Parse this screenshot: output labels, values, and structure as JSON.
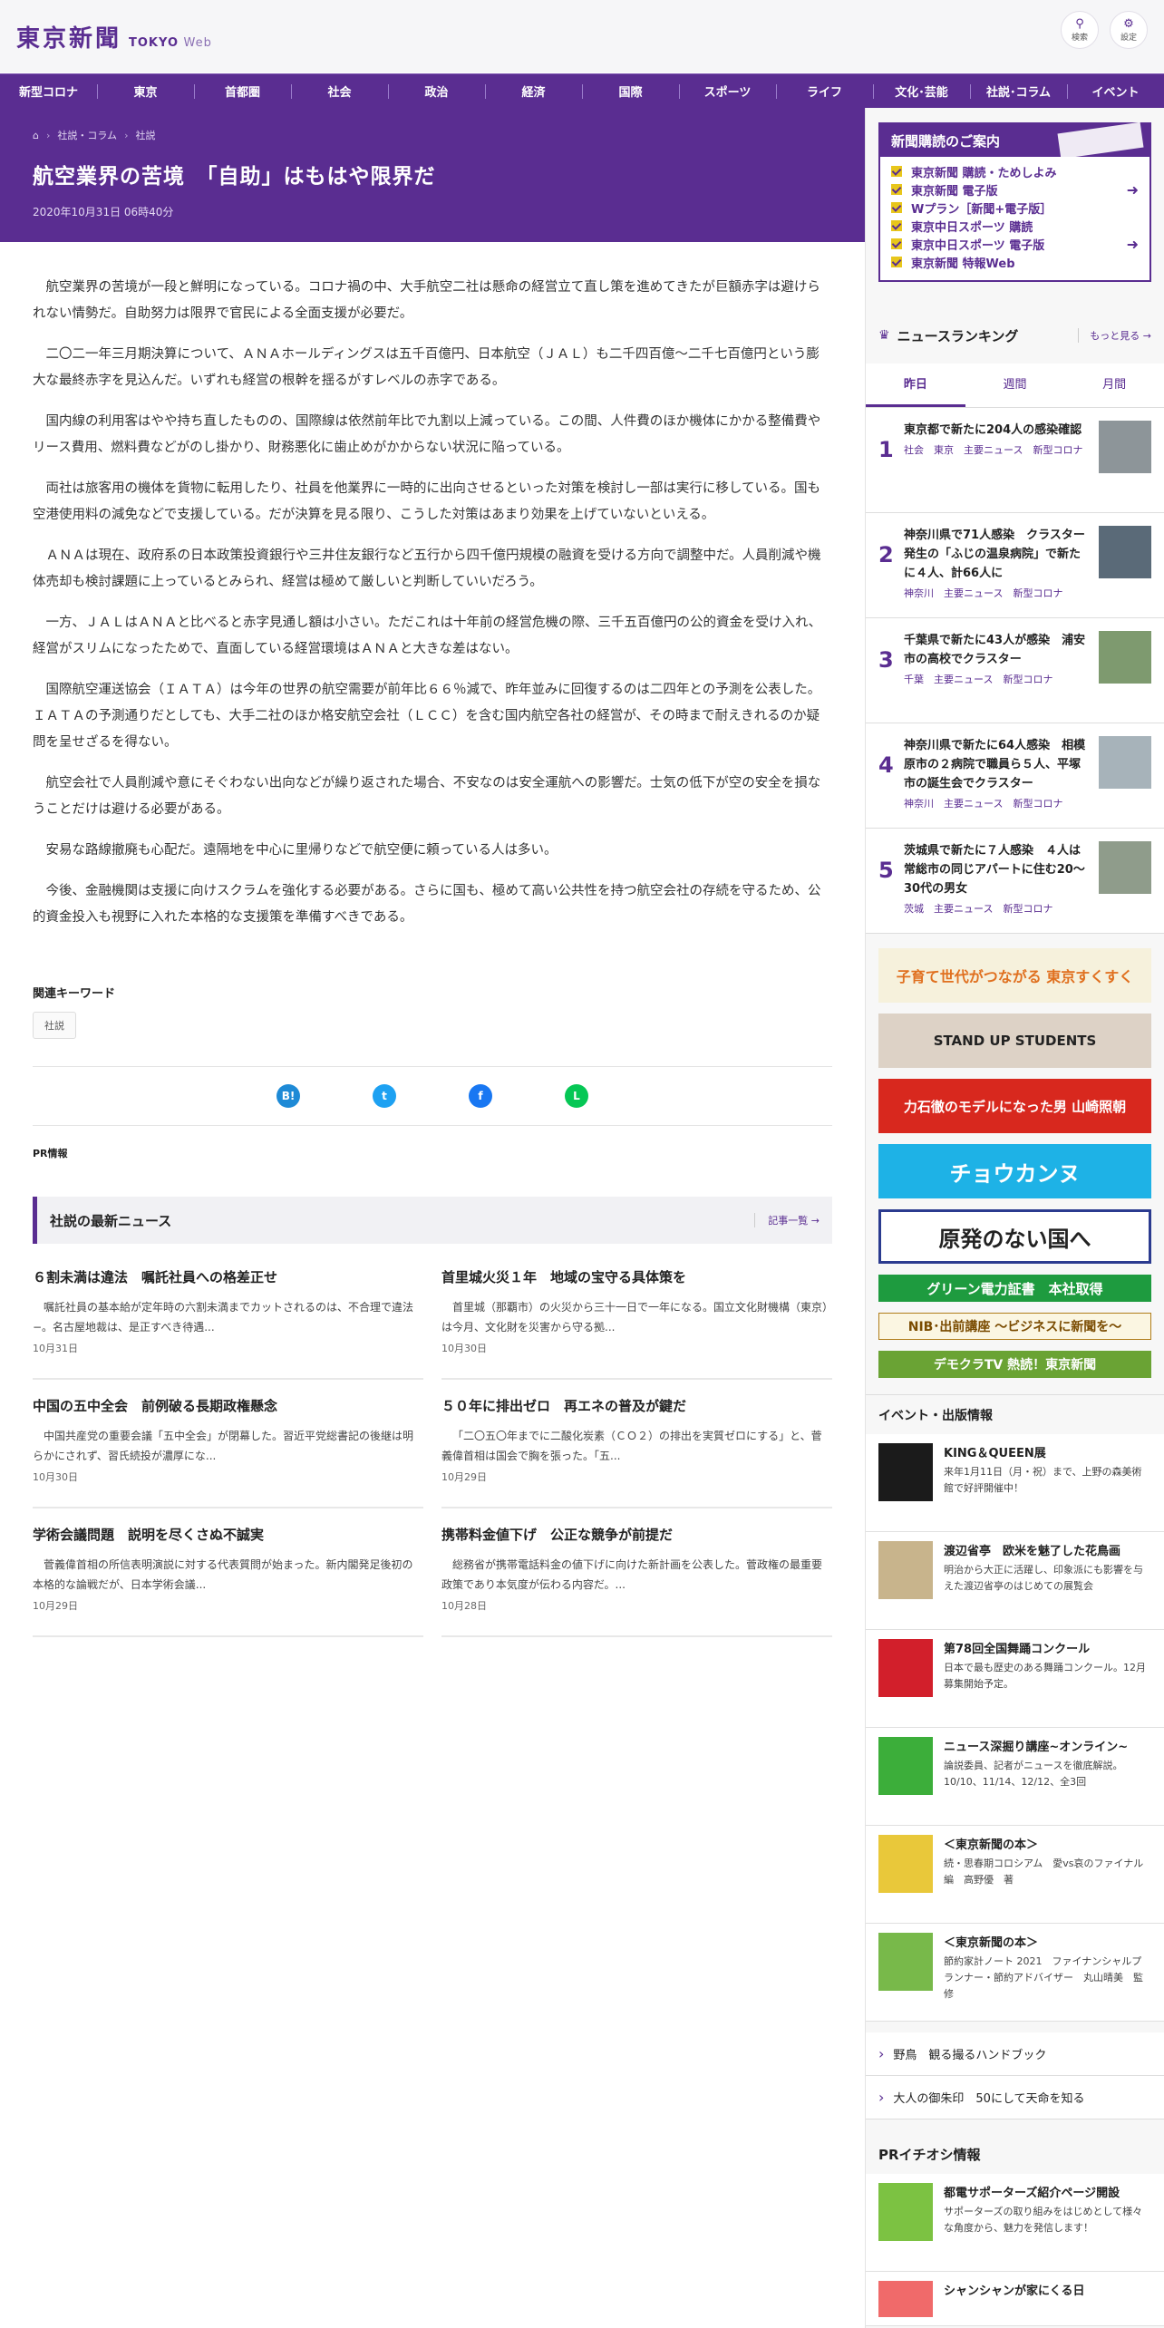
{
  "header": {
    "logo_jp": "東京新聞",
    "logo_en": "TOKYO",
    "logo_web": "Web",
    "search": "検索",
    "settings": "設定"
  },
  "nav": [
    "新型コロナ",
    "東京",
    "首都圏",
    "社会",
    "政治",
    "経済",
    "国際",
    "スポーツ",
    "ライフ",
    "文化･芸能",
    "社説･コラム",
    "イベント"
  ],
  "breadcrumb": {
    "level1": "社説・コラム",
    "level2": "社説"
  },
  "article": {
    "title": "航空業界の苦境　「自助」はもはや限界だ",
    "date": "2020年10月31日 06時40分",
    "paragraphs": [
      "航空業界の苦境が一段と鮮明になっている。コロナ禍の中、大手航空二社は懸命の経営立て直し策を進めてきたが巨額赤字は避けられない情勢だ。自助努力は限界で官民による全面支援が必要だ。",
      "二〇二一年三月期決算について、ＡＮＡホールディングスは五千百億円、日本航空（ＪＡＬ）も二千四百億〜二千七百億円という膨大な最終赤字を見込んだ。いずれも経営の根幹を揺るがすレベルの赤字である。",
      "国内線の利用客はやや持ち直したものの、国際線は依然前年比で九割以上減っている。この間、人件費のほか機体にかかる整備費やリース費用、燃料費などがのし掛かり、財務悪化に歯止めがかからない状況に陥っている。",
      "両社は旅客用の機体を貨物に転用したり、社員を他業界に一時的に出向させるといった対策を検討し一部は実行に移している。国も空港使用料の減免などで支援している。だが決算を見る限り、こうした対策はあまり効果を上げていないといえる。",
      "ＡＮＡは現在、政府系の日本政策投資銀行や三井住友銀行など五行から四千億円規模の融資を受ける方向で調整中だ。人員削減や機体売却も検討課題に上っているとみられ、経営は極めて厳しいと判断していいだろう。",
      "一方、ＪＡＬはＡＮＡと比べると赤字見通し額は小さい。ただこれは十年前の経営危機の際、三千五百億円の公的資金を受け入れ、経営がスリムになったためで、直面している経営環境はＡＮＡと大きな差はない。",
      "国際航空運送協会（ＩＡＴＡ）は今年の世界の航空需要が前年比６６％減で、昨年並みに回復するのは二四年との予測を公表した。ＩＡＴＡの予測通りだとしても、大手二社のほか格安航空会社（ＬＣＣ）を含む国内航空各社の経営が、その時まで耐えきれるのか疑問を呈せざるを得ない。",
      "航空会社で人員削減や意にそぐわない出向などが繰り返された場合、不安なのは安全運航への影響だ。士気の低下が空の安全を損なうことだけは避ける必要がある。",
      "安易な路線撤廃も心配だ。遠隔地を中心に里帰りなどで航空便に頼っている人は多い。",
      "今後、金融機関は支援に向けスクラムを強化する必要がある。さらに国も、極めて高い公共性を持つ航空会社の存続を守るため、公的資金投入も視野に入れた本格的な支援策を準備すべきである。"
    ]
  },
  "keywords": {
    "title": "関連キーワード",
    "tag": "社説"
  },
  "share": [
    "B!",
    "t",
    "f",
    "L"
  ],
  "pr": "PR情報",
  "latest": {
    "title": "社説の最新ニュース",
    "more": "記事一覧",
    "items": [
      {
        "h": "６割未満は違法　嘱託社員への格差正せ",
        "s": "嘱託社員の基本給が定年時の六割未満までカットされるのは、不合理で違法−。名古屋地裁は、是正すべき待遇...",
        "d": "10月31日"
      },
      {
        "h": "首里城火災１年　地域の宝守る具体策を",
        "s": "首里城（那覇市）の火災から三十一日で一年になる。国立文化財機構（東京）は今月、文化財を災害から守る拠...",
        "d": "10月30日"
      },
      {
        "h": "中国の五中全会　前例破る長期政権懸念",
        "s": "中国共産党の重要会議「五中全会」が閉幕した。習近平党総書記の後継は明らかにされず、習氏続投が濃厚にな...",
        "d": "10月30日"
      },
      {
        "h": "５０年に排出ゼロ　再エネの普及が鍵だ",
        "s": "「二〇五〇年までに二酸化炭素（ＣＯ２）の排出を実質ゼロにする」と、菅義偉首相は国会で胸を張った。「五...",
        "d": "10月29日"
      },
      {
        "h": "学術会議問題　説明を尽くさぬ不誠実",
        "s": "菅義偉首相の所信表明演説に対する代表質問が始まった。新内閣発足後初の本格的な論戦だが、日本学術会議...",
        "d": "10月29日"
      },
      {
        "h": "携帯料金値下げ　公正な競争が前提だ",
        "s": "総務省が携帯電話料金の値下げに向けた新計画を公表した。菅政権の最重要政策であり本気度が伝わる内容だ。...",
        "d": "10月28日"
      }
    ]
  },
  "subscribe": {
    "title": "新聞購読のご案内",
    "items": [
      "東京新聞 購読・ためしよみ",
      "東京新聞 電子版",
      "Wプラン［新聞+電子版］",
      "東京中日スポーツ 購読",
      "東京中日スポーツ 電子版",
      "東京新聞 特報Web"
    ]
  },
  "ranking": {
    "title": "ニュースランキング",
    "more": "もっと見る",
    "tabs": [
      "昨日",
      "週間",
      "月間"
    ],
    "items": [
      {
        "n": "1",
        "h": "東京都で新たに204人の感染確認",
        "k": "社会　東京　主要ニュース　新型コロナ"
      },
      {
        "n": "2",
        "h": "神奈川県で71人感染　クラスター発生の「ふじの温泉病院」で新たに４人、計66人に",
        "k": "神奈川　主要ニュース　新型コロナ"
      },
      {
        "n": "3",
        "h": "千葉県で新たに43人が感染　浦安市の高校でクラスター",
        "k": "千葉　主要ニュース　新型コロナ"
      },
      {
        "n": "4",
        "h": "神奈川県で新たに64人感染　相模原市の２病院で職員ら５人、平塚市の誕生会でクラスター",
        "k": "神奈川　主要ニュース　新型コロナ"
      },
      {
        "n": "5",
        "h": "茨城県で新たに７人感染　４人は常総市の同じアパートに住む20～30代の男女",
        "k": "茨城　主要ニュース　新型コロナ"
      }
    ]
  },
  "banners": [
    "子育て世代がつながる 東京すくすく",
    "STAND UP STUDENTS",
    "力石徹のモデルになった男 山崎照朝",
    "チョウカンヌ",
    "原発のない国へ",
    "グリーン電力証書　本社取得",
    "NIB･出前講座 〜ビジネスに新聞を〜",
    "デモクラTV 熱読！東京新聞"
  ],
  "events": {
    "title": "イベント・出版情報",
    "items": [
      {
        "h": "KING＆QUEEN展",
        "s": "来年1月11日（月・祝）まで、上野の森美術館で好評開催中！"
      },
      {
        "h": "渡辺省亭　欧米を魅了した花鳥画",
        "s": "明治から大正に活躍し、印象派にも影響を与えた渡辺省亭のはじめての展覧会"
      },
      {
        "h": "第78回全国舞踊コンクール",
        "s": "日本で最も歴史のある舞踊コンクール。12月募集開始予定。"
      },
      {
        "h": "ニュース深掘り講座~オンライン~",
        "s": "論説委員、記者がニュースを徹底解説。10/10、11/14、12/12、全3回"
      },
      {
        "h": "＜東京新聞の本＞",
        "s": "続・思春期コロシアム　愛vs哀のファイナル編　高野優　著"
      },
      {
        "h": "＜東京新聞の本＞",
        "s": "節約家計ノート 2021　ファイナンシャルプランナー・節約アドバイザー　丸山晴美　監修"
      }
    ]
  },
  "links": [
    "野鳥　観る撮るハンドブック",
    "大人の御朱印　50にして天命を知る"
  ],
  "pr_pickup": {
    "title": "PRイチオシ情報",
    "items": [
      {
        "h": "都電サポーターズ紹介ページ開設",
        "s": "サポーターズの取り組みをはじめとして様々な角度から、魅力を発信します！"
      },
      {
        "h": "シャンシャンが家にくる日",
        "s": ""
      }
    ]
  }
}
